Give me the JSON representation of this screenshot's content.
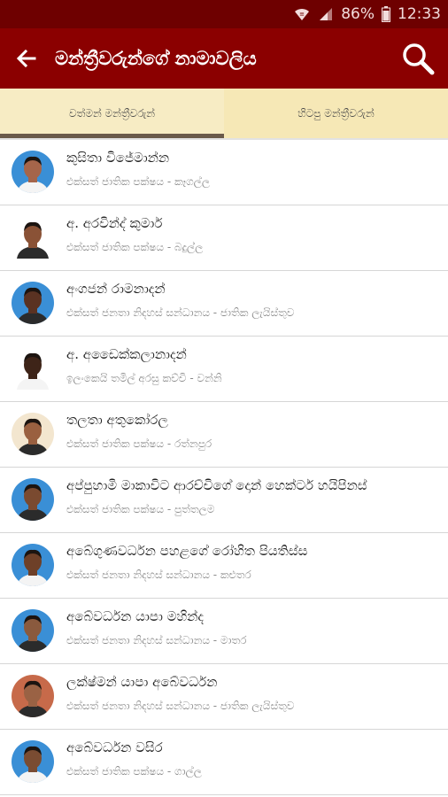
{
  "status_bar": {
    "battery": "86%",
    "time": "12:33"
  },
  "app_bar": {
    "title": "මන්ත්‍රීවරුන්ගේ නාමාවලිය"
  },
  "tabs": [
    {
      "label": "වත්මන් මන්ත්‍රීවරුන්",
      "selected": true
    },
    {
      "label": "හිටපු මන්ත්‍රීවරුන්",
      "selected": false
    }
  ],
  "members": [
    {
      "name": "කුසිතා විජේමාන්න",
      "details": "එක්සත් ජාතික පක්ෂය - කෑගල්ල",
      "avatar_bg": "#3a8fd6",
      "skin": "#a5654a"
    },
    {
      "name": "අ. අරවින්ද් කුමාර්",
      "details": "එක්සත් ජාතික පක්ෂය - බදුල්ල",
      "avatar_bg": "#ffffff",
      "skin": "#8a5236"
    },
    {
      "name": "අංගජන් රාමනාදන්",
      "details": "එක්සත් ජනතා නිදහස් සන්ධානය - ජාතික ලැයිස්තුව",
      "avatar_bg": "#3a8fd6",
      "skin": "#5a3222"
    },
    {
      "name": "අ. අඩෛක්කලානාදන්",
      "details": "ඉලංකෙයි තමිල් අරසු කච්චි - වන්නි",
      "avatar_bg": "#ffffff",
      "skin": "#3e2418"
    },
    {
      "name": "තලතා අතුකෝරල",
      "details": "එක්සත් ජාතික පක්ෂය - රත්නපුර",
      "avatar_bg": "#f3e6cf",
      "skin": "#9a6040"
    },
    {
      "name": "අප්පුහාමි මාකාවිට ආරච්චිගේ දොන් හෙක්ටර් හයිපිනස්",
      "details": "එක්සත් ජාතික පක්ෂය - පුත්තලම",
      "avatar_bg": "#3a8fd6",
      "skin": "#7a4a30"
    },
    {
      "name": "අබේගුණවර්ධන පහළගේ රෝහිත පියතිස්ස",
      "details": "එක්සත් ජනතා නිදහස් සන්ධානය - කළුතර",
      "avatar_bg": "#3a8fd6",
      "skin": "#6e4028"
    },
    {
      "name": "අබේවර්ධන යාපා මහින්ද",
      "details": "එක්සත් ජනතා නිදහස් සන්ධානය - මාතර",
      "avatar_bg": "#3a8fd6",
      "skin": "#8a5a3e"
    },
    {
      "name": "ලක්ෂ්මන් යාපා අබේවර්ධන",
      "details": "එක්සත් ජනතා නිදහස් සන්ධානය - ජාතික ලැයිස්තුව",
      "avatar_bg": "#c76a4a",
      "skin": "#9a6244"
    },
    {
      "name": "අබේවර්ධන වසිර",
      "details": "එක්සත් ජාතික පක්ෂය - ගාල්ල",
      "avatar_bg": "#3a8fd6",
      "skin": "#7a4c32"
    }
  ]
}
